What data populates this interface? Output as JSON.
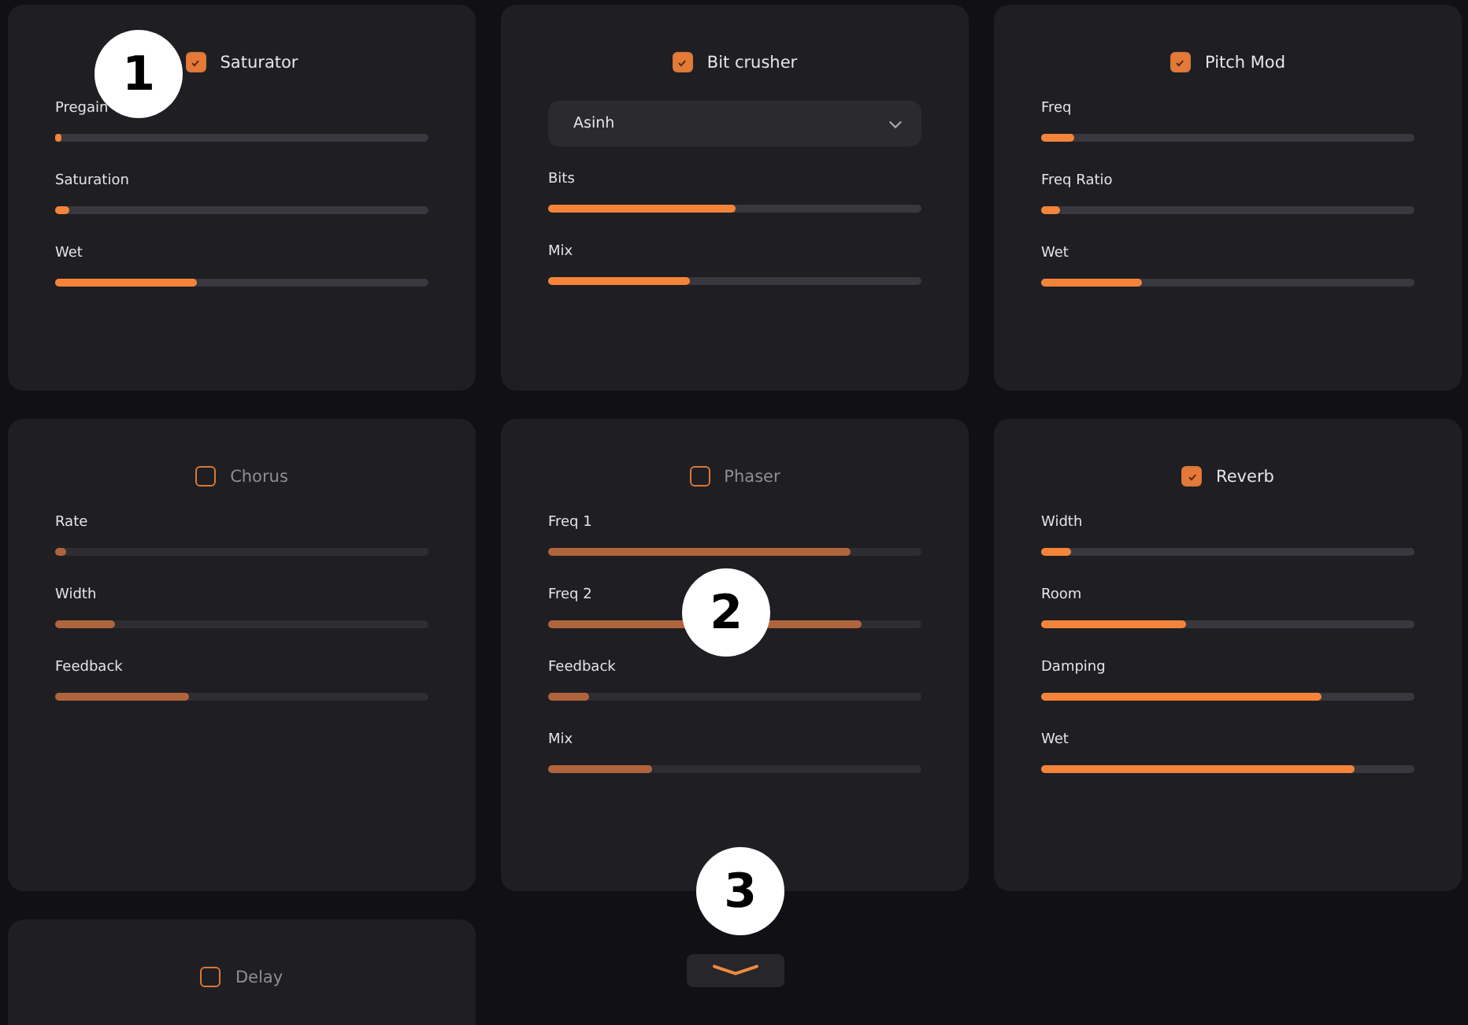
{
  "effects": [
    {
      "title": "Saturator",
      "enabled": true,
      "controls": [
        {
          "kind": "slider",
          "label": "Pregain",
          "level": 0.01
        },
        {
          "kind": "slider",
          "label": "Saturation",
          "level": 0.04
        },
        {
          "kind": "slider",
          "label": "Wet",
          "level": 0.38
        }
      ]
    },
    {
      "title": "Bit crusher",
      "enabled": true,
      "controls": [
        {
          "kind": "dropdown",
          "value": "Asinh"
        },
        {
          "kind": "slider",
          "label": "Bits",
          "level": 0.5
        },
        {
          "kind": "slider",
          "label": "Mix",
          "level": 0.38
        }
      ]
    },
    {
      "title": "Pitch Mod",
      "enabled": true,
      "controls": [
        {
          "kind": "slider",
          "label": "Freq",
          "level": 0.09
        },
        {
          "kind": "slider",
          "label": "Freq Ratio",
          "level": 0.05
        },
        {
          "kind": "slider",
          "label": "Wet",
          "level": 0.27
        }
      ]
    },
    {
      "title": "Chorus",
      "enabled": false,
      "controls": [
        {
          "kind": "slider",
          "label": "Rate",
          "level": 0.03
        },
        {
          "kind": "slider",
          "label": "Width",
          "level": 0.16
        },
        {
          "kind": "slider",
          "label": "Feedback",
          "level": 0.36
        }
      ]
    },
    {
      "title": "Phaser",
      "enabled": false,
      "controls": [
        {
          "kind": "slider",
          "label": "Freq 1",
          "level": 0.81
        },
        {
          "kind": "slider",
          "label": "Freq 2",
          "level": 0.84
        },
        {
          "kind": "slider",
          "label": "Feedback",
          "level": 0.11
        },
        {
          "kind": "slider",
          "label": "Mix",
          "level": 0.28
        }
      ]
    },
    {
      "title": "Reverb",
      "enabled": true,
      "controls": [
        {
          "kind": "slider",
          "label": "Width",
          "level": 0.08
        },
        {
          "kind": "slider",
          "label": "Room",
          "level": 0.39
        },
        {
          "kind": "slider",
          "label": "Damping",
          "level": 0.75
        },
        {
          "kind": "slider",
          "label": "Wet",
          "level": 0.84
        }
      ]
    },
    {
      "title": "Delay",
      "enabled": false
    }
  ],
  "callouts": [
    "1",
    "2",
    "3"
  ]
}
